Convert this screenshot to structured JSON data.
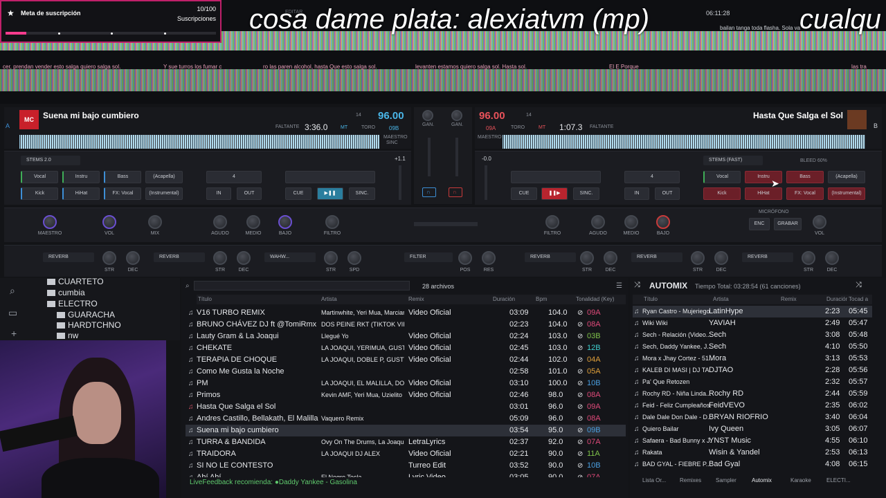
{
  "overlay": {
    "sub_goal_title": "Meta de suscripción",
    "sub_count": "10/100",
    "sub_label": "Suscripciones",
    "scroll_text": "cosa dame plata: alexiatvm (mp)",
    "scroll_text_2": "cualqu"
  },
  "top_bar": {
    "edit_label": "EDITAR",
    "clock": "06:11:28"
  },
  "lyrics": {
    "line1": "cer, prendan vender esto salga quiero salga sol.",
    "line2": "Y sue   turros los fumar c",
    "line3": "ro las paren alcohol, hasta Que esto salga sol.",
    "line4": "levanten estamos quiero salga sol. Hasta sol.",
    "line5": "El E    Porque",
    "line6": "bailan tanga toda flasha. Sola   va",
    "line7": "las tra"
  },
  "deck_a": {
    "letter": "A",
    "title": "Suena mi bajo cumbiero",
    "bpm": "96.00",
    "key_num": "14",
    "remaining_label": "FALTANTE",
    "time": "3:36.0",
    "key": "09B",
    "mode": "MT",
    "toro": "TORO",
    "master": "MAESTRO",
    "sync_label": "SINC",
    "stems_label": "STEMS 2.0",
    "stems": [
      "Vocal",
      "Instru",
      "Bass",
      "(Acapella)",
      "Kick",
      "HiHat",
      "FX: Vocal",
      "(Instrumental)"
    ],
    "loop_size": "4",
    "in": "IN",
    "out": "OUT",
    "cue": "CUE",
    "sync": "SINC.",
    "fx_labels": [
      "MAESTRO",
      "VOL",
      "MIX",
      "AGUDO",
      "MEDIO",
      "BAJO",
      "FILTRO"
    ],
    "fx_slots": [
      "REVERB",
      "REVERB",
      "WAHW..."
    ],
    "fx_knobs": [
      "STR",
      "DEC",
      "STR",
      "DEC",
      "STR",
      "SPD"
    ],
    "offset": "+1.1"
  },
  "deck_b": {
    "letter": "B",
    "title": "Hasta Que Salga el Sol",
    "bpm": "96.00",
    "key_num": "14",
    "remaining_label": "FALTANTE",
    "time": "1:07.3",
    "key": "09A",
    "mode": "MT",
    "toro": "TORO",
    "master": "MAESTRO",
    "stems_label": "STEMS (FAST)",
    "bleed": "BLEED 60%",
    "stems": [
      "Vocal",
      "Instru",
      "Bass",
      "(Acapella)",
      "Kick",
      "HiHat",
      "FX: Vocal",
      "(Instrumental)"
    ],
    "loop_size": "4",
    "in": "IN",
    "out": "OUT",
    "cue": "CUE",
    "sync": "SINC.",
    "fx_labels": [
      "FILTRO",
      "AGUDO",
      "MEDIO",
      "BAJO"
    ],
    "fx_slots": [
      "REVERB",
      "REVERB",
      "REVERB"
    ],
    "fx_knobs": [
      "STR",
      "DEC",
      "STR",
      "DEC",
      "STR",
      "DEC"
    ],
    "offset": "-0.0",
    "mic_label": "MICRÓFONO",
    "enc": "ENC",
    "record": "GRABAR",
    "vol": "VOL"
  },
  "mixer": {
    "gain": "GAN.",
    "filter_slot": "FILTER",
    "pos": "POS",
    "res": "RES"
  },
  "tree": {
    "items": [
      "CUARTETO",
      "cumbia",
      "ELECTRO",
      "GUARACHA",
      "HARDTCHNO",
      "nw"
    ]
  },
  "browser": {
    "file_count": "28 archivos",
    "columns": [
      "Título",
      "Artista",
      "Remix",
      "Duración",
      "Bpm",
      "Tonalidad (Key)"
    ],
    "rows": [
      {
        "title": "V16 TURBO REMIX",
        "artist": "Martinwhite, Yeri Mua, Marcianeke",
        "remix": "Video Oficial",
        "dur": "03:09",
        "bpm": "104.0",
        "key": "09A",
        "kc": "key"
      },
      {
        "title": "BRUNO CHÁVEZ DJ ft @TomiRmx",
        "artist": "DOS PEINE RKT (TIKTOK VIR...",
        "remix": "",
        "dur": "02:23",
        "bpm": "104.0",
        "key": "08A",
        "kc": "key"
      },
      {
        "title": "Lauty Gram & La Joaqui",
        "artist": "Llegué Yo",
        "remix": "Video Oficial",
        "dur": "02:24",
        "bpm": "103.0",
        "key": "03B",
        "kc": "key g"
      },
      {
        "title": "CHEKATE",
        "artist": "LA JOAQUI, YERIMUA, GUSTY...",
        "remix": "Video Oficial",
        "dur": "02:45",
        "bpm": "103.0",
        "key": "12B",
        "kc": "key t"
      },
      {
        "title": "TERAPIA DE CHOQUE",
        "artist": "LA JOAQUI, DOBLE P, GUSTY...",
        "remix": "Video Oficial",
        "dur": "02:44",
        "bpm": "102.0",
        "key": "04A",
        "kc": "key o"
      },
      {
        "title": "Como Me Gusta la Noche",
        "artist": "",
        "remix": "",
        "dur": "02:58",
        "bpm": "101.0",
        "key": "05A",
        "kc": "key o"
      },
      {
        "title": "PM",
        "artist": "LA JOAQUI, EL MALILLA, DOB...",
        "remix": "Video Oficial",
        "dur": "03:10",
        "bpm": "100.0",
        "key": "10B",
        "kc": "key b"
      },
      {
        "title": "Primos",
        "artist": "Kevin AMF, Yeri Mua, Uzielito M...",
        "remix": "Video Oficial",
        "dur": "02:46",
        "bpm": "98.0",
        "key": "08A",
        "kc": "key"
      },
      {
        "title": "Hasta Que Salga el Sol",
        "artist": "",
        "remix": "",
        "dur": "03:01",
        "bpm": "96.0",
        "key": "09A",
        "kc": "key"
      },
      {
        "title": "Andres Castillo, Bellakath, El Malilla , El Bogueti...",
        "artist": "Vaquero Remix",
        "remix": "",
        "dur": "05:09",
        "bpm": "96.0",
        "key": "08A",
        "kc": "key"
      },
      {
        "title": "Suena mi bajo cumbiero",
        "artist": "",
        "remix": "",
        "dur": "03:54",
        "bpm": "95.0",
        "key": "09B",
        "kc": "key b"
      },
      {
        "title": "TURRA & BANDIDA",
        "artist": "Ovy On The Drums, La Joaqui",
        "remix": "LetraLyrics",
        "dur": "02:37",
        "bpm": "92.0",
        "key": "07A",
        "kc": "key"
      },
      {
        "title": "TRAIDORA",
        "artist": "LA JOAQUI DJ ALEX",
        "remix": "Video Oficial",
        "dur": "02:21",
        "bpm": "90.0",
        "key": "11A",
        "kc": "key g"
      },
      {
        "title": "SI NO LE CONTESTO",
        "artist": "",
        "remix": "Turreo Edit",
        "dur": "03:52",
        "bpm": "90.0",
        "key": "10B",
        "kc": "key b"
      },
      {
        "title": "Ahí Ahí",
        "artist": "El Negro Tecla",
        "remix": "Lyric Video",
        "dur": "03:05",
        "bpm": "90.0",
        "key": "07A",
        "kc": "key"
      }
    ],
    "status": "LiveFeedback recomienda: ●Daddy Yankee - Gasolina"
  },
  "automix": {
    "title": "AUTOMIX",
    "total": "Tiempo Total: 03:28:54 (61 canciones)",
    "columns": [
      "Título",
      "Artista",
      "Remix",
      "Duración",
      "Tocad a"
    ],
    "rows": [
      {
        "title": "Ryan Castro - Mujeriego",
        "artist": "LatinHype",
        "dur": "2:23",
        "at": "05:45"
      },
      {
        "title": "Wiki Wiki",
        "artist": "YAVIAH",
        "dur": "2:49",
        "at": "05:47"
      },
      {
        "title": "Sech - Relación (Video...",
        "artist": "Sech",
        "dur": "3:08",
        "at": "05:48"
      },
      {
        "title": "Sech, Daddy Yankee, J...",
        "artist": "Sech",
        "dur": "4:10",
        "at": "05:50"
      },
      {
        "title": "Mora x Jhay Cortez - 51...",
        "artist": "Mora",
        "dur": "3:13",
        "at": "05:53"
      },
      {
        "title": "KALEB DI MASI | DJ TA...",
        "artist": "DJTAO",
        "dur": "2:28",
        "at": "05:56"
      },
      {
        "title": "Pa' Que Retozen",
        "artist": "",
        "dur": "2:32",
        "at": "05:57"
      },
      {
        "title": "Rochy RD - Niña Linda...",
        "artist": "Rochy RD",
        "dur": "2:44",
        "at": "05:59"
      },
      {
        "title": "Feid - Feliz Cumpleaños...",
        "artist": "FeidVEVO",
        "dur": "2:35",
        "at": "06:02"
      },
      {
        "title": "Dale Dale Don Dale - D...",
        "artist": "BRYAN RIOFRIO",
        "dur": "3:40",
        "at": "06:04"
      },
      {
        "title": "Quiero Bailar",
        "artist": "Ivy Queen",
        "dur": "3:05",
        "at": "06:07"
      },
      {
        "title": "Safaera - Bad Bunny x J...",
        "artist": "YNST Music",
        "dur": "4:55",
        "at": "06:10"
      },
      {
        "title": "Rakata",
        "artist": "Wisin & Yandel",
        "dur": "2:53",
        "at": "06:13"
      },
      {
        "title": "BAD GYAL - FIEBRE P...",
        "artist": "Bad Gyal",
        "dur": "4:08",
        "at": "06:15"
      }
    ],
    "tabs": [
      "Lista Or...",
      "Remixes",
      "Sampler",
      "Automix",
      "Karaoke",
      "ELECTI..."
    ]
  }
}
